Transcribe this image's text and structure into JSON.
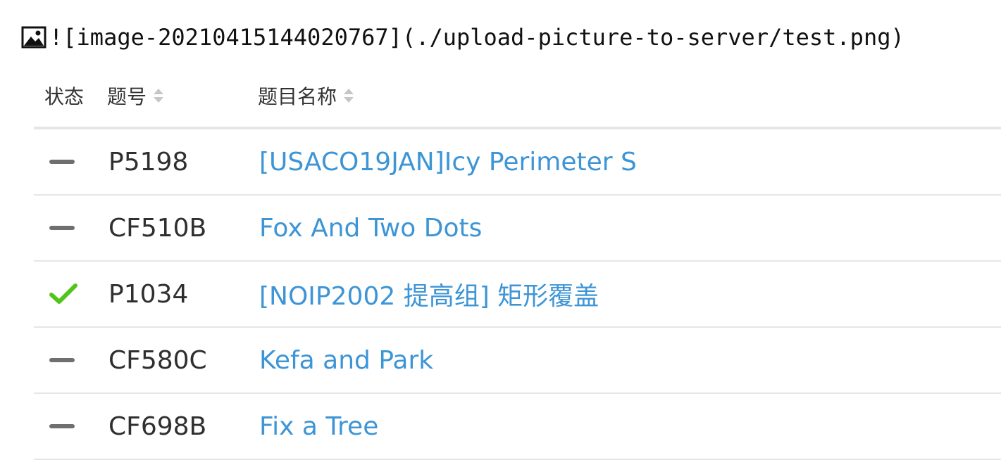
{
  "markdown_line": {
    "icon": "image-icon",
    "text": "![image-20210415144020767](./upload-picture-to-server/test.png)"
  },
  "table": {
    "headers": {
      "status": "状态",
      "pid": "题号",
      "title": "题目名称"
    },
    "rows": [
      {
        "status": "not-attempted",
        "pid": "P5198",
        "title": "[USACO19JAN]Icy Perimeter S"
      },
      {
        "status": "not-attempted",
        "pid": "CF510B",
        "title": "Fox And Two Dots"
      },
      {
        "status": "accepted",
        "pid": "P1034",
        "title": "[NOIP2002 提高组] 矩形覆盖"
      },
      {
        "status": "not-attempted",
        "pid": "CF580C",
        "title": "Kefa and Park"
      },
      {
        "status": "not-attempted",
        "pid": "CF698B",
        "title": "Fix a Tree"
      }
    ]
  },
  "colors": {
    "link": "#3d95d6",
    "accepted": "#52c41a",
    "not_attempted": "#6f6f6f",
    "divider": "#e6e6e6"
  }
}
